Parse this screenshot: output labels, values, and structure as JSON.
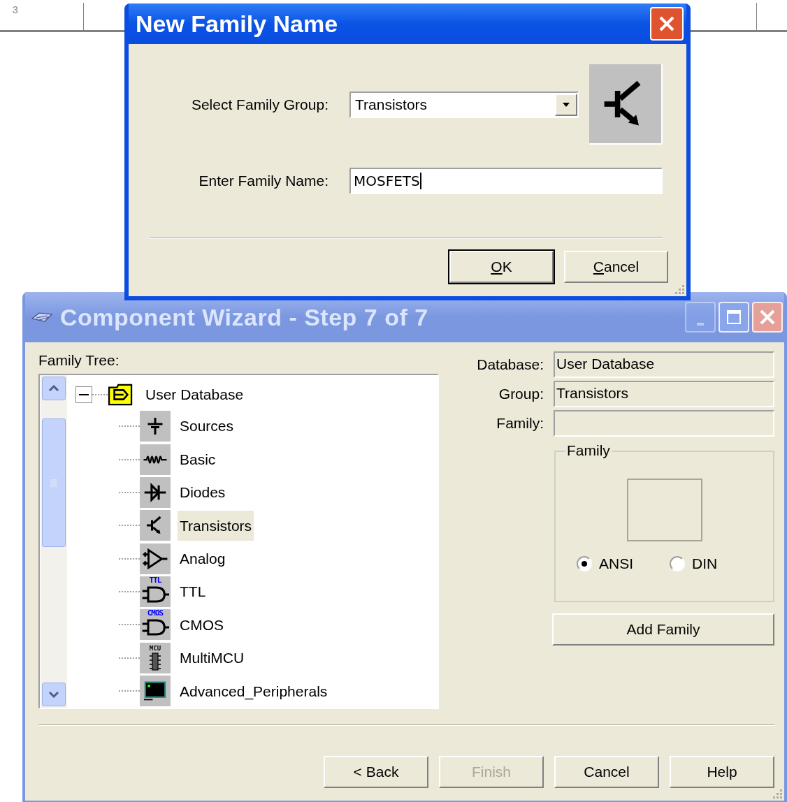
{
  "ruler": {
    "label": "3"
  },
  "wizard": {
    "title": "Component Wizard - Step 7 of 7",
    "window_buttons": [
      {
        "kind": "minimize",
        "disabled": true
      },
      {
        "kind": "maximize",
        "disabled": false
      },
      {
        "kind": "close",
        "disabled": false
      }
    ],
    "family_tree_label": "Family Tree:",
    "tree": {
      "label": "User Database",
      "expanded": true,
      "children": [
        {
          "label": "Sources",
          "kind": "sources",
          "selected": false
        },
        {
          "label": "Basic",
          "kind": "basic",
          "selected": false
        },
        {
          "label": "Diodes",
          "kind": "diodes",
          "selected": false
        },
        {
          "label": "Transistors",
          "kind": "transistors",
          "selected": true
        },
        {
          "label": "Analog",
          "kind": "analog",
          "selected": false
        },
        {
          "label": "TTL",
          "kind": "ttl",
          "icon_text": "TTL",
          "selected": false
        },
        {
          "label": "CMOS",
          "kind": "cmos",
          "icon_text": "CMOS",
          "selected": false
        },
        {
          "label": "MultiMCU",
          "kind": "mcu",
          "icon_text": "MCU",
          "selected": false
        },
        {
          "label": "Advanced_Peripherals",
          "kind": "peripherals",
          "selected": false
        }
      ]
    },
    "fields": [
      {
        "label": "Database:",
        "value": "User Database"
      },
      {
        "label": "Group:",
        "value": "Transistors"
      },
      {
        "label": "Family:"
      }
    ],
    "family_group": {
      "legend": "Family",
      "radios": [
        {
          "label": "ANSI",
          "selected": true
        },
        {
          "label": "DIN",
          "selected": false
        }
      ]
    },
    "add_button": "Add Family",
    "buttons": [
      {
        "label": "< Back",
        "disabled": false
      },
      {
        "label": "Finish",
        "disabled": true
      },
      {
        "label": "Cancel",
        "disabled": false
      },
      {
        "label": "Help",
        "disabled": false
      }
    ]
  },
  "dialog": {
    "title": "New Family Name",
    "group_label": "Select Family Group:",
    "group_value": "Transistors",
    "name_label": "Enter Family Name:",
    "name_value": "MOSFETS",
    "name_focused": true,
    "buttons": [
      {
        "label": "OK",
        "default": true,
        "underline_first": true
      },
      {
        "label": "Cancel",
        "default": false,
        "underline_first": true
      }
    ]
  }
}
